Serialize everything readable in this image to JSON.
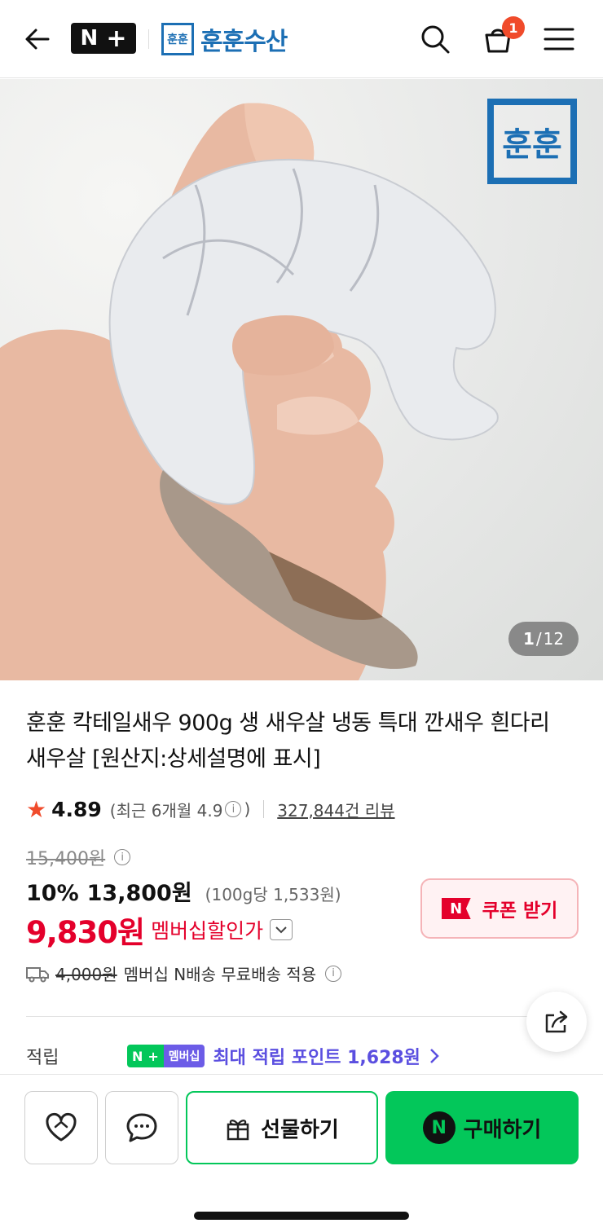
{
  "header": {
    "nplus_label": "N",
    "brand_logo_text": "훈훈",
    "brand_name": "훈훈수산",
    "cart_count": "1"
  },
  "hero": {
    "logo_text": "훈훈",
    "counter_current": "1",
    "counter_sep": "/",
    "counter_total": "12"
  },
  "product": {
    "title": "훈훈 칵테일새우 900g 생 새우살 냉동 특대 깐새우 흰다리새우살 [원산지:상세설명에 표시]",
    "rating": "4.89",
    "recent_prefix": "(최근 6개월 4.9",
    "recent_suffix": ")",
    "review_count": "327,844건 리뷰",
    "original_price": "15,400원",
    "discount": "10%",
    "sale_price": "13,800원",
    "unit_price": "(100g당 1,533원)",
    "member_price": "9,830원",
    "member_label": "멤버십할인가",
    "coupon_label": "쿠폰 받기",
    "coupon_icon": "N",
    "shipping_original": "4,000원",
    "shipping_text": "멤버십 N배송 무료배송 적용",
    "points_label": "적립",
    "points_badge_n": "N",
    "points_badge_member": "멤버십",
    "points_text": "최대 적립 포인트 1,628원"
  },
  "bottom": {
    "gift_label": "선물하기",
    "buy_label": "구매하기",
    "buy_icon": "N"
  },
  "colors": {
    "brand_blue": "#1c6fb4",
    "naver_green": "#03c75a",
    "member_red": "#e4002b",
    "star_orange": "#f04b2b",
    "points_purple": "#5b4fe0"
  }
}
